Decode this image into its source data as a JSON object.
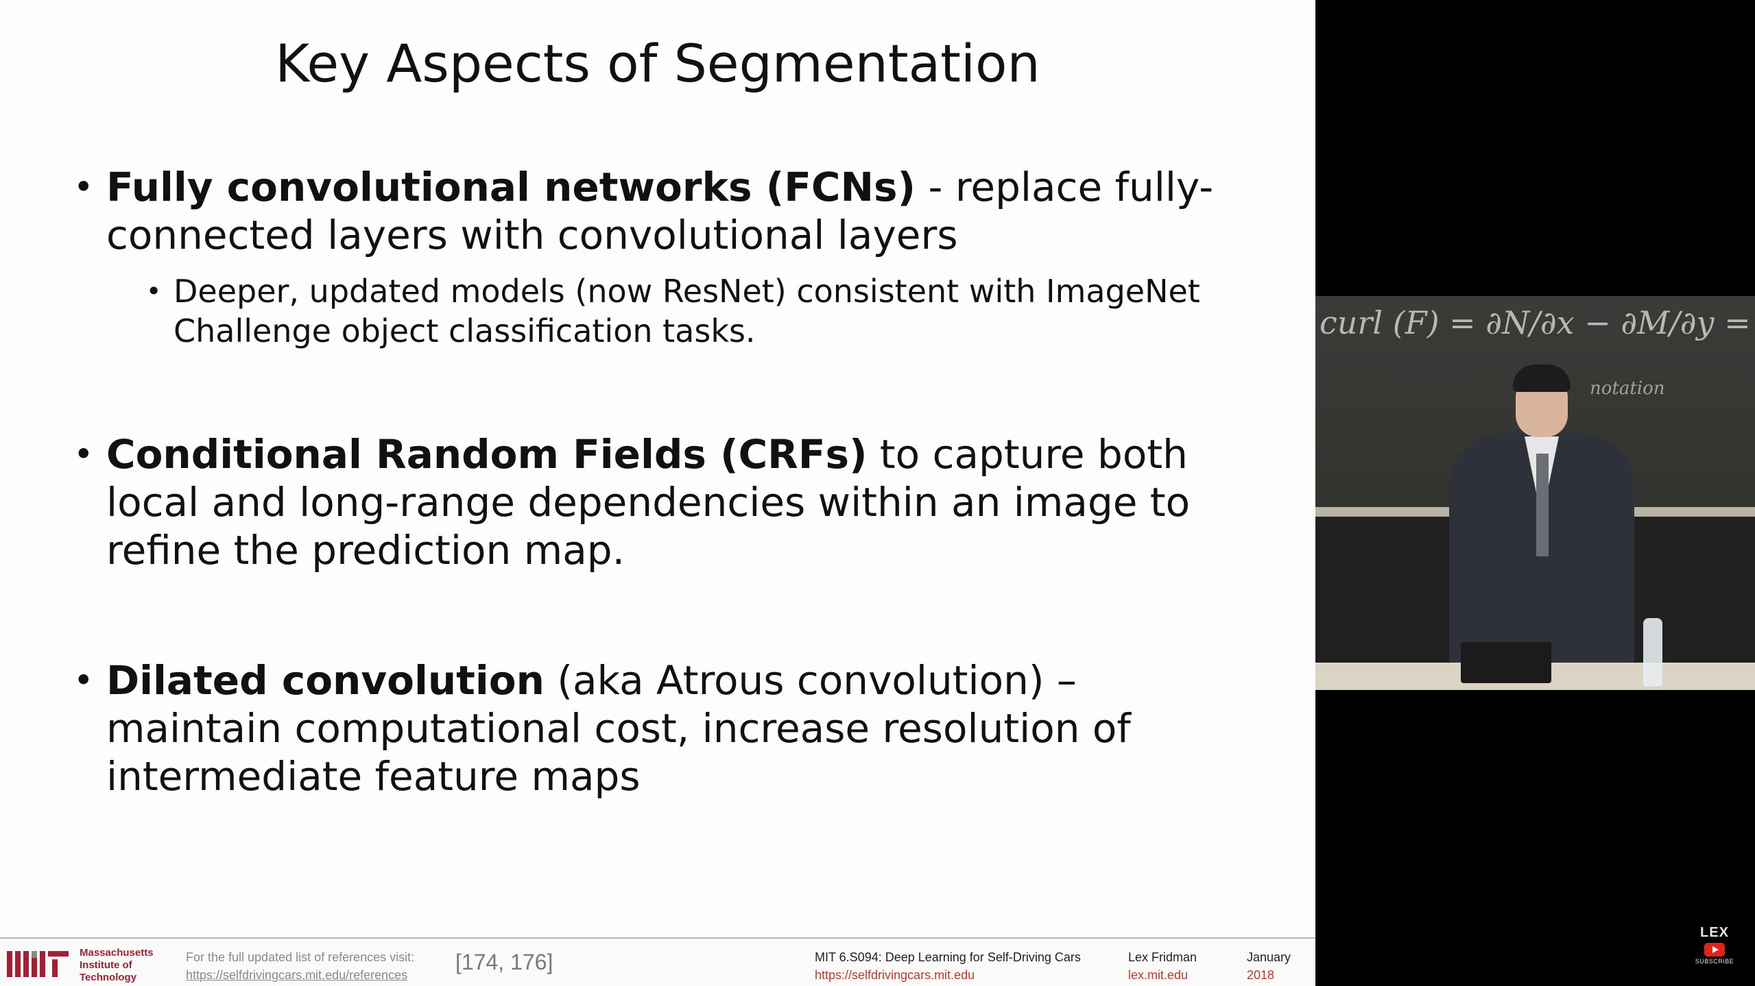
{
  "slide": {
    "title": "Key Aspects of Segmentation",
    "bullets": [
      {
        "bold": "Fully convolutional networks (FCNs)",
        "text": " - replace fully-connected layers with convolutional layers",
        "sub": "Deeper, updated models (now ResNet) consistent with ImageNet Challenge object classification tasks."
      },
      {
        "bold": "Conditional Random Fields (CRFs)",
        "text": " to capture both local and long-range dependencies within an image to refine the prediction map."
      },
      {
        "bold": "Dilated convolution",
        "text": " (aka Atrous convolution) – maintain computational cost, increase resolution of intermediate feature maps"
      }
    ]
  },
  "footer": {
    "mit_name": [
      "Massachusetts",
      "Institute of",
      "Technology"
    ],
    "ref_label": "For the full updated list of references visit:",
    "ref_url": "https://selfdrivingcars.mit.edu/references",
    "ref_nums": "[174, 176]",
    "course_title": "MIT 6.S094: Deep Learning for Self-Driving Cars",
    "course_url": "https://selfdrivingcars.mit.edu",
    "author": "Lex Fridman",
    "author_url": "lex.mit.edu",
    "month": "January",
    "year": "2018"
  },
  "video": {
    "board_text": "curl (F) = ∂N/∂x − ∂M/∂y = k̂·(∇×F)",
    "board_note": "notation"
  },
  "channel": {
    "name": "LEX",
    "subscribe": "SUBSCRIBE"
  },
  "colors": {
    "mit_red": "#a31f34",
    "link_red": "#c0392b",
    "youtube_red": "#e62117"
  }
}
